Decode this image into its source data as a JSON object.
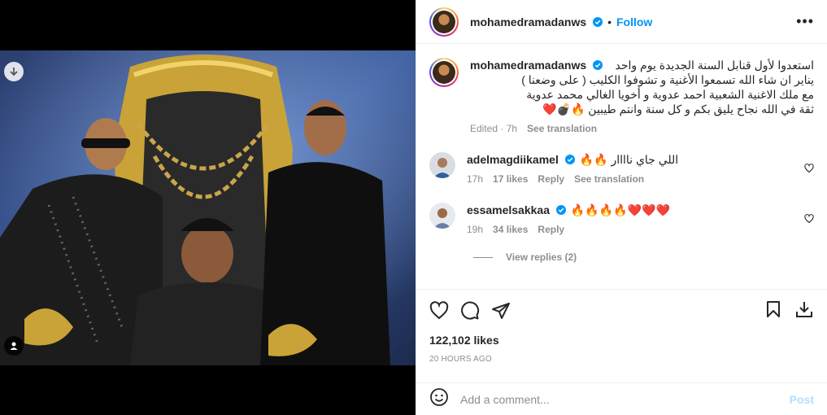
{
  "post": {
    "username": "mohamedramadanws",
    "follow_label": "Follow",
    "more_label": "•••",
    "caption_lines": [
      "استعدوا لأول قنابل السنة الجديدة يوم واحد",
      "يناير ان شاء الله تسمعوا الأغنية و تشوفوا الكليب ( على وضعنا )",
      "مع ملك الاغنية الشعبية احمد عدوية و أخويا الغالي محمد عدوية",
      "ثقة في الله نجاح يليق بكم و كل سنة وانتم طيبين 🔥💣❤️"
    ],
    "caption_time": "Edited · 7h",
    "see_translation": "See translation",
    "likes": "122,102 likes",
    "posted_ago": "20 HOURS AGO",
    "add_comment_placeholder": "Add a comment...",
    "post_label": "Post"
  },
  "comments": [
    {
      "username": "adelmagdiikamel",
      "text": "اللي جاي ناااار 🔥🔥",
      "time": "17h",
      "likes": "17 likes",
      "reply": "Reply",
      "translation": "See translation"
    },
    {
      "username": "essamelsakkaa",
      "text": "🔥🔥🔥🔥❤️❤️❤️",
      "time": "19h",
      "likes": "34 likes",
      "reply": "Reply",
      "view_replies": "View replies (2)"
    }
  ],
  "colors": {
    "accent": "#0095f6",
    "muted": "#8e8e8e",
    "heart": "#ed4956"
  }
}
